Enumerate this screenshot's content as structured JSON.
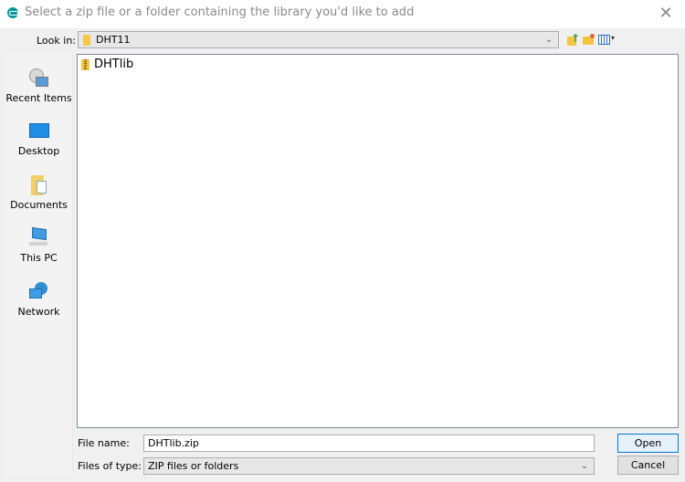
{
  "window": {
    "title": "Select a zip file or a folder containing the library you'd like to add",
    "app_icon": "arduino-icon",
    "close_icon": "close-icon",
    "close_glyph": "✕"
  },
  "toolbar": {
    "look_in_label": "Look in:",
    "look_in_value": "DHT11",
    "dropdown_glyph": "⌄",
    "up_arrow_glyph": "↑",
    "view_menu_glyph": "▾",
    "icons": [
      "up-one-level-icon",
      "create-new-folder-icon",
      "view-menu-icon"
    ]
  },
  "sidebar": {
    "items": [
      {
        "label": "Recent Items",
        "icon": "recent-items-icon"
      },
      {
        "label": "Desktop",
        "icon": "desktop-icon"
      },
      {
        "label": "Documents",
        "icon": "documents-icon"
      },
      {
        "label": "This PC",
        "icon": "this-pc-icon"
      },
      {
        "label": "Network",
        "icon": "network-icon"
      }
    ]
  },
  "files": [
    {
      "name": "DHTlib",
      "icon": "zip-folder-icon"
    }
  ],
  "bottom": {
    "file_name_label": "File name:",
    "file_name_value": "DHTlib.zip",
    "files_of_type_label": "Files of type:",
    "files_of_type_value": "ZIP files or folders",
    "open_label": "Open",
    "cancel_label": "Cancel"
  },
  "colors": {
    "accent": "#0078d7",
    "app_icon": "#00979c"
  }
}
